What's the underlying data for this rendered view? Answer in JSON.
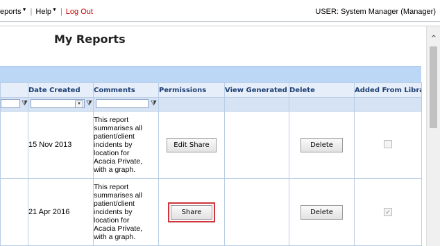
{
  "menu": {
    "reports_label": "eports",
    "help_label": "Help",
    "logout_label": "Log Out",
    "user_text": "USER: System Manager (Manager)"
  },
  "page": {
    "title": "My Reports"
  },
  "table": {
    "headers": [
      "Date Created",
      "Comments",
      "Permissions",
      "View Generated",
      "Delete",
      "Added From Librar"
    ],
    "rows": [
      {
        "date": "15 Nov 2013",
        "comment_lines": [
          "This report",
          "summarises all",
          "patient/client",
          "incidents by",
          "location for",
          "Acacia Private,",
          "with a graph."
        ],
        "permission_button": "Edit Share",
        "delete_button": "Delete",
        "added_from_library": false
      },
      {
        "date": "21 Apr 2016",
        "comment_lines": [
          "This report",
          "summarises all",
          "patient/client",
          "incidents by",
          "location for",
          "Acacia Private,",
          "with a graph."
        ],
        "permission_button": "Share",
        "delete_button": "Delete",
        "added_from_library": true
      }
    ]
  },
  "colors": {
    "logout": "#cc0000",
    "header_text": "#1c3e73",
    "bluebar": "#bcd6f5",
    "highlight": "#d0333d"
  }
}
